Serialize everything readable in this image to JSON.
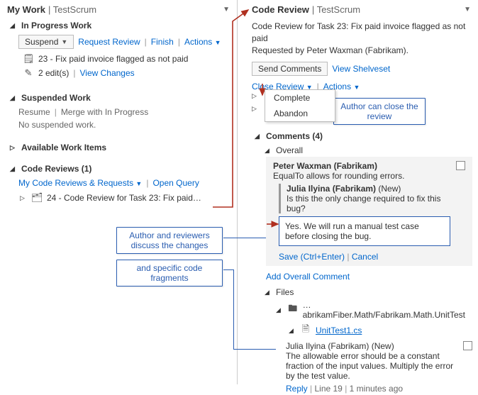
{
  "left": {
    "title": "My Work",
    "subtitle": "TestScrum",
    "inprogress": {
      "header": "In Progress Work",
      "suspend": "Suspend",
      "request_review": "Request Review",
      "finish": "Finish",
      "actions": "Actions",
      "task": "23 - Fix paid invoice flagged as not paid",
      "edits": "2 edit(s)",
      "view_changes": "View Changes"
    },
    "suspended": {
      "header": "Suspended Work",
      "resume": "Resume",
      "merge": "Merge with In Progress",
      "none": "No suspended work."
    },
    "available": {
      "header": "Available Work Items"
    },
    "code_reviews": {
      "header": "Code Reviews (1)",
      "my_link": "My Code Reviews & Requests",
      "open_query": "Open Query",
      "item": "24 - Code Review for Task 23: Fix paid…"
    }
  },
  "right": {
    "title": "Code Review",
    "subtitle": "TestScrum",
    "desc_line1": "Code Review for Task 23: Fix paid invoice flagged as not paid",
    "desc_line2": "Requested by Peter Waxman (Fabrikam).",
    "send_comments": "Send Comments",
    "view_shelveset": "View Shelveset",
    "close_review": "Close Review",
    "actions": "Actions",
    "menu": {
      "complete": "Complete",
      "abandon": "Abandon"
    },
    "comments_header": "Comments (4)",
    "overall": "Overall",
    "pw_name": "Peter Waxman (Fabrikam)",
    "pw_text": "EqualTo allows for rounding errors.",
    "ji_name": "Julia Ilyina (Fabrikam)",
    "new_tag": "(New)",
    "ji_q": "Is this the only change required to fix this bug?",
    "reply_text": "Yes. We will run a manual test case before closing the bug.",
    "save": "Save (Ctrl+Enter)",
    "cancel": "Cancel",
    "add_overall": "Add Overall Comment",
    "files_header": "Files",
    "file_path": "…abrikamFiber.Math/Fabrikam.Math.UnitTest",
    "file_name": "UnitTest1.cs",
    "file_comment": "The allowable error should be a constant fraction of the input values. Multiply the error by the test value.",
    "reply": "Reply",
    "line_ref": "Line 19",
    "time": "1 minutes ago"
  },
  "callouts": {
    "close": "Author can close the review",
    "discuss": "Author and reviewers discuss the changes",
    "fragments": "and specific code fragments"
  }
}
